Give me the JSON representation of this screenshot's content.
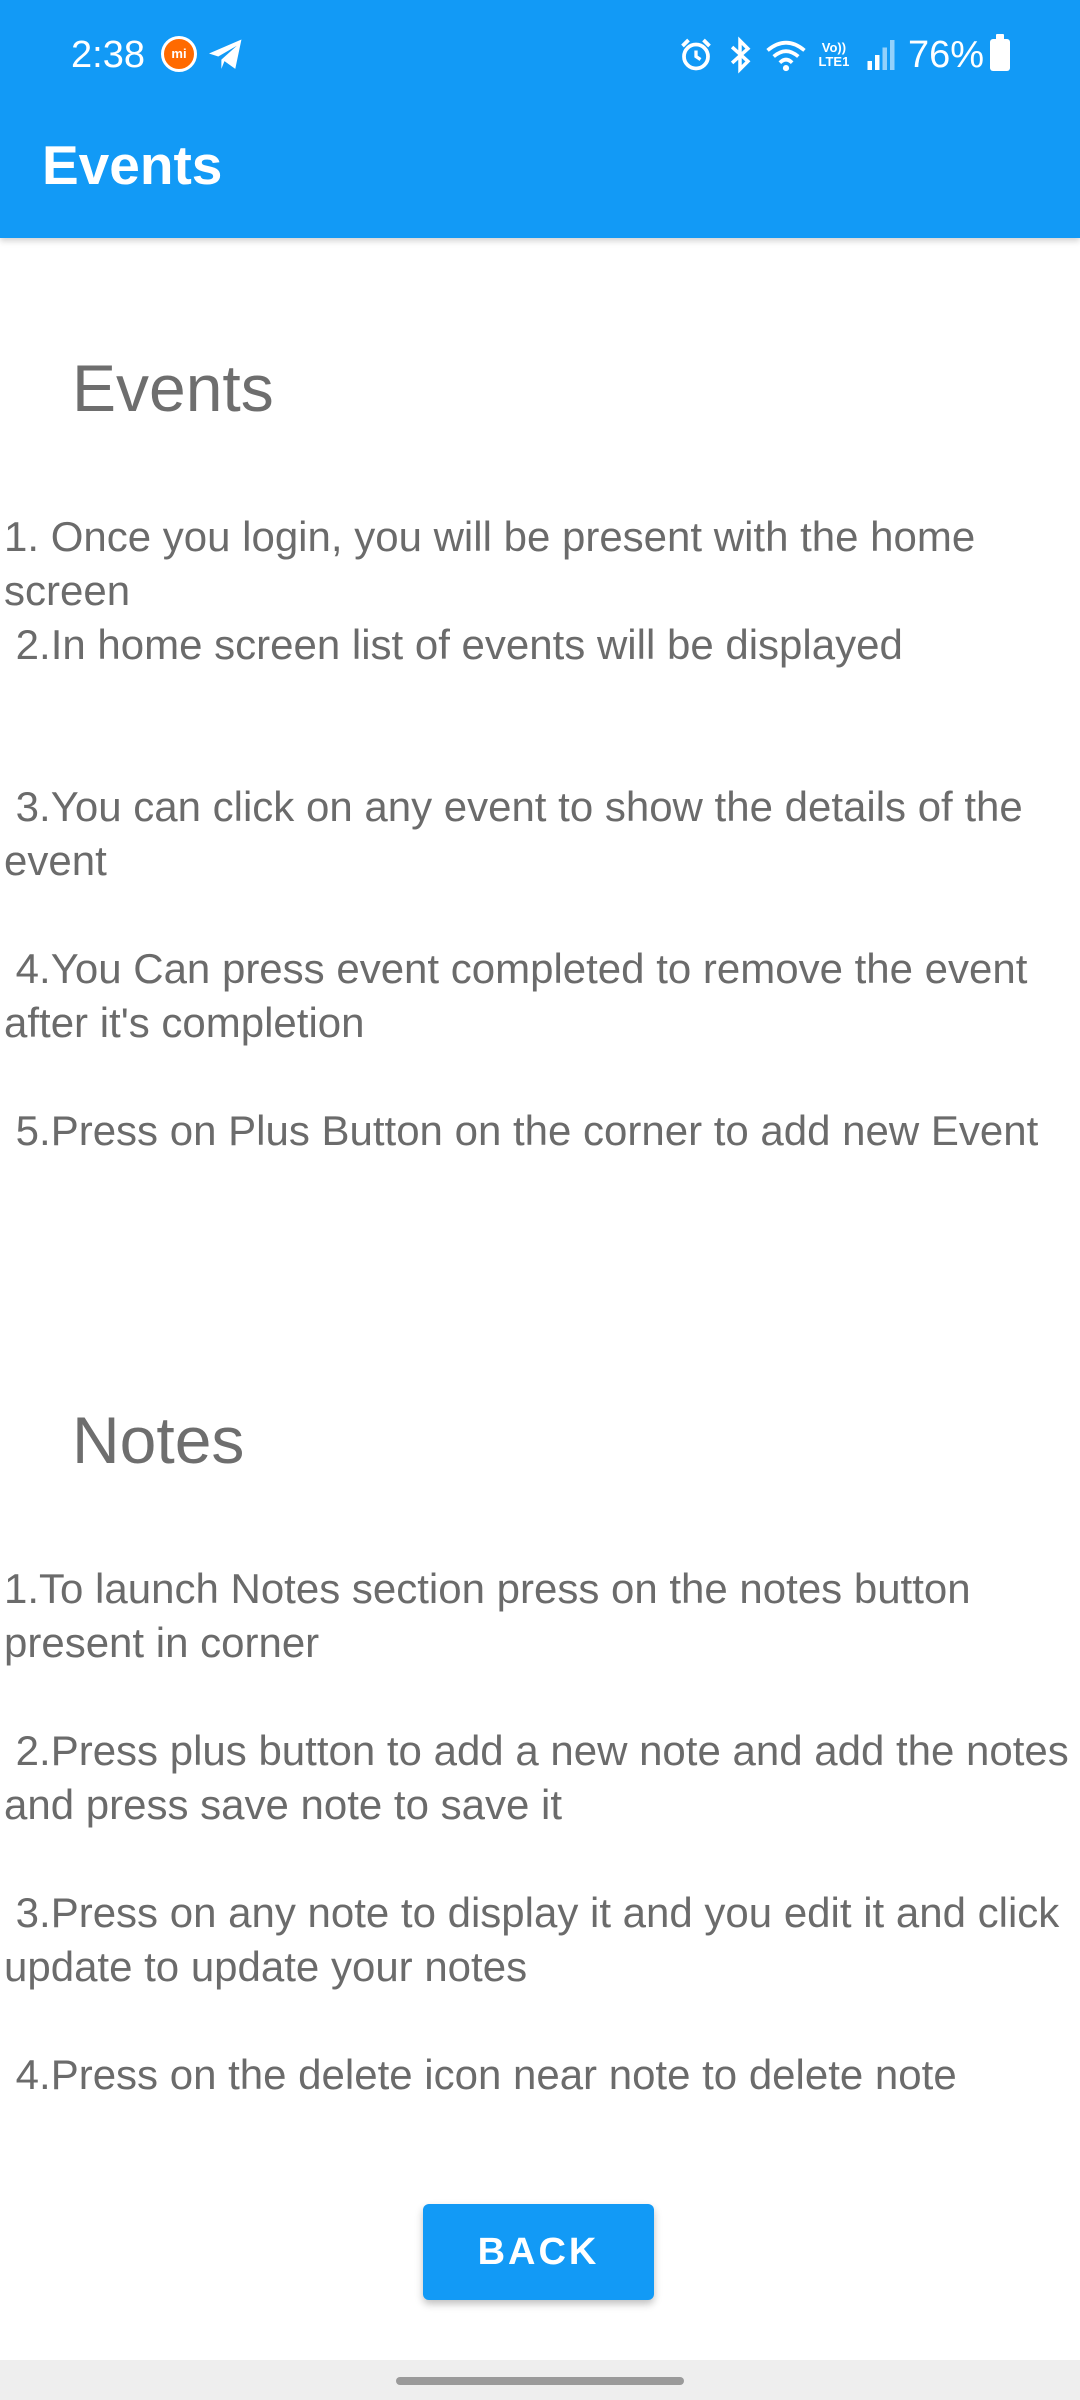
{
  "status_bar": {
    "time": "2:38",
    "mi_badge": "mi",
    "volte": "Vo)) LTE1",
    "battery": "76%",
    "icons": [
      "mi-icon",
      "telegram-icon",
      "alarm-icon",
      "bluetooth-icon",
      "wifi-icon",
      "volte-icon",
      "signal-icon",
      "battery-icon"
    ]
  },
  "app_bar": {
    "title": "Events",
    "color": "#129af6"
  },
  "sections": [
    {
      "heading": "Events",
      "items": [
        "1. Once you login, you will be present with the home screen",
        " 2.In home screen list of events will be displayed",
        " 3.You can click on any event to show the details of the event",
        " 4.You Can press event completed to remove the event after it's completion",
        " 5.Press on Plus Button on the corner to add new Event"
      ]
    },
    {
      "heading": "Notes",
      "items": [
        "1.To launch Notes section press on the notes button present in corner",
        " 2.Press plus button to add a new note and add the notes and press save note to save it",
        " 3.Press on any note to display it and you edit it and click update to update your notes",
        " 4.Press on the delete icon near note to delete note"
      ]
    }
  ],
  "back_button": {
    "label": "BACK"
  }
}
